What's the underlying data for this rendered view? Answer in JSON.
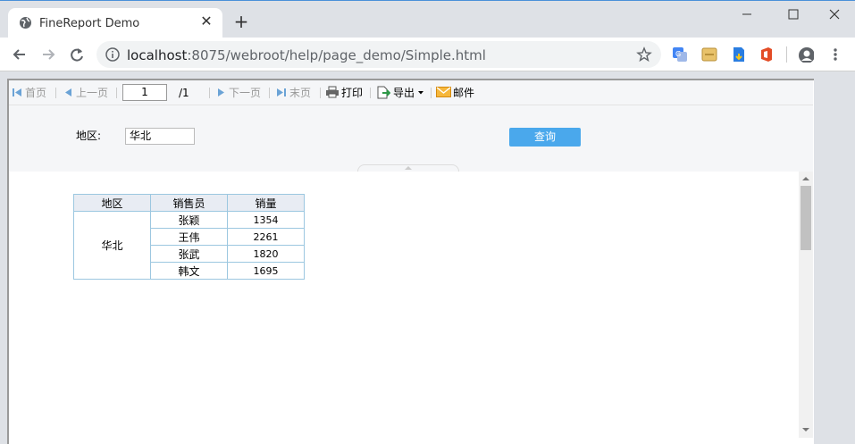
{
  "browser": {
    "tab_title": "FineReport Demo",
    "close_glyph": "✕",
    "newtab_glyph": "+",
    "url_host": "localhost",
    "url_path": ":8075/webroot/help/page_demo/Simple.html"
  },
  "report_toolbar": {
    "first": "首页",
    "prev": "上一页",
    "page_input": "1",
    "page_total": "/1",
    "next": "下一页",
    "last": "末页",
    "print": "打印",
    "export": "导出",
    "mail": "邮件"
  },
  "params": {
    "region_label": "地区:",
    "region_value": "华北",
    "query_label": "查询"
  },
  "table": {
    "headers": [
      "地区",
      "销售员",
      "销量"
    ],
    "region": "华北",
    "rows": [
      {
        "name": "张颖",
        "sales": "1354"
      },
      {
        "name": "王伟",
        "sales": "2261"
      },
      {
        "name": "张武",
        "sales": "1820"
      },
      {
        "name": "韩文",
        "sales": "1695"
      }
    ]
  }
}
